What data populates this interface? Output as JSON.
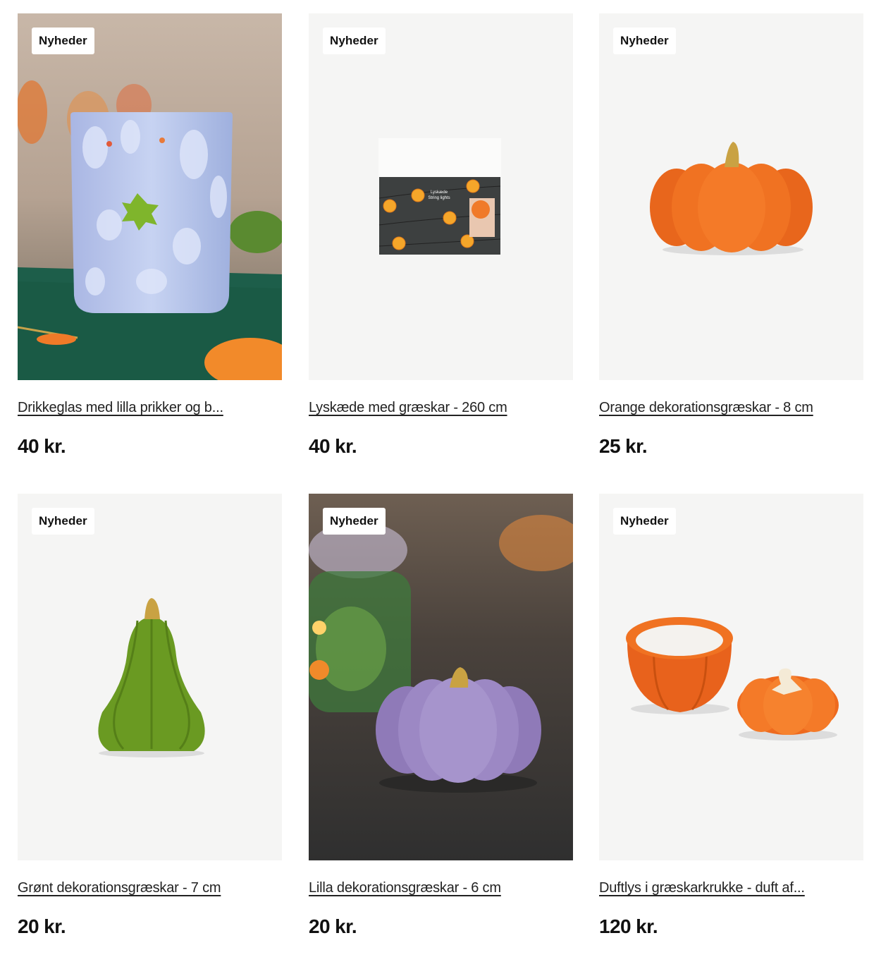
{
  "products": [
    {
      "badge": "Nyheder",
      "title": "Drikkeglas med lilla prikker og b...",
      "price": "40 kr.",
      "image": "blue-spotted-glass-photo"
    },
    {
      "badge": "Nyheder",
      "title": "Lyskæde med græskar - 260 cm",
      "price": "40 kr.",
      "image": "pumpkin-string-lights-package"
    },
    {
      "badge": "Nyheder",
      "title": "Orange dekorationsgræskar - 8 cm",
      "price": "25 kr.",
      "image": "orange-ceramic-pumpkin"
    },
    {
      "badge": "Nyheder",
      "title": "Grønt dekorationsgræskar - 7 cm",
      "price": "20 kr.",
      "image": "green-ceramic-gourd"
    },
    {
      "badge": "Nyheder",
      "title": "Lilla dekorationsgræskar - 6 cm",
      "price": "20 kr.",
      "image": "purple-ceramic-pumpkin-photo"
    },
    {
      "badge": "Nyheder",
      "title": "Duftlys i græskarkrukke - duft af...",
      "price": "120 kr.",
      "image": "pumpkin-jar-candle"
    }
  ],
  "package_text": {
    "line1": "Lyskæde",
    "line2": "String lights"
  },
  "colors": {
    "card_bg": "#f5f5f4",
    "badge_bg": "#ffffff",
    "text": "#111111"
  }
}
